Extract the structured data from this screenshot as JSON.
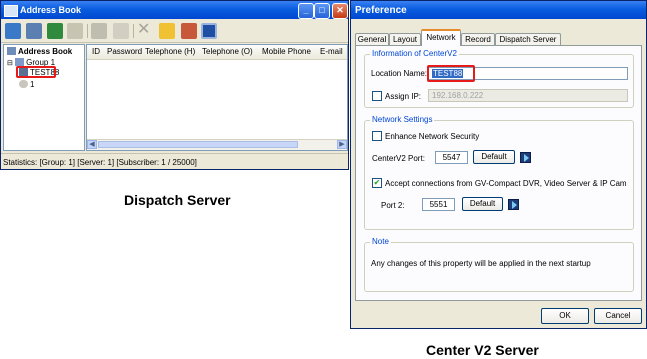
{
  "address_book": {
    "title": "Address Book",
    "tree": {
      "root": "Address Book",
      "group": "Group 1",
      "selected_item": "TEST88",
      "child": "1"
    },
    "columns": [
      "ID",
      "Password",
      "Telephone (H)",
      "Telephone (O)",
      "Mobile Phone",
      "E-mail"
    ],
    "status": "Statistics: [Group: 1]  [Server: 1]  [Subscriber: 1 / 25000]",
    "caption": "Dispatch Server"
  },
  "preference": {
    "title": "Preference",
    "tabs": [
      "General",
      "Layout",
      "Network",
      "Record",
      "Dispatch Server"
    ],
    "active_tab": "Network",
    "info_group": {
      "label": "Information of CenterV2",
      "location_label": "Location Name:",
      "location_value": "TEST88",
      "assign_ip_label": "Assign IP:",
      "assign_ip_value": "192.168.0.222"
    },
    "network_group": {
      "label": "Network Settings",
      "enhance_label": "Enhance Network Security",
      "port_label": "CenterV2 Port:",
      "port_value": "5547",
      "default_label": "Default",
      "accept_label": "Accept connections from GV-Compact DVR, Video Server & IP Cam",
      "port2_label": "Port 2:",
      "port2_value": "5551",
      "default2_label": "Default"
    },
    "note_group": {
      "label": "Note",
      "text": "Any changes of this property will be applied in the next startup"
    },
    "ok_label": "OK",
    "cancel_label": "Cancel",
    "caption": "Center V2 Server"
  }
}
